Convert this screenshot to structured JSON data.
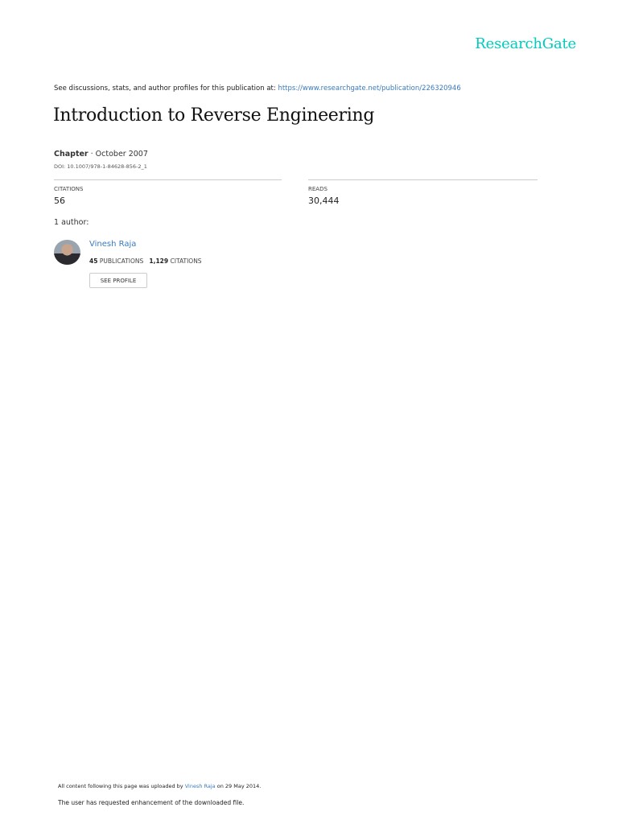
{
  "brand": {
    "logo": "ResearchGate",
    "accent": "#00ccbb",
    "link_color": "#3a7abf"
  },
  "header": {
    "intro": "See discussions, stats, and author profiles for this publication at: ",
    "url": "https://www.researchgate.net/publication/226320946"
  },
  "publication": {
    "title": "Introduction to Reverse Engineering",
    "type": "Chapter",
    "date": " · October 2007",
    "doi": "DOI: 10.1007/978-1-84628-856-2_1"
  },
  "stats": {
    "citations_label": "CITATIONS",
    "citations": "56",
    "reads_label": "READS",
    "reads": "30,444"
  },
  "authors": {
    "heading": "1 author:",
    "list": [
      {
        "name": "Vinesh Raja",
        "publications": "45",
        "publications_label": " PUBLICATIONS",
        "citations": "1,129",
        "citations_label": " CITATIONS",
        "button": "SEE PROFILE"
      }
    ]
  },
  "footer": {
    "uploaded_prefix": "All content following this page was uploaded by ",
    "uploader": "Vinesh Raja",
    "uploaded_suffix": " on 29 May 2014.",
    "note": "The user has requested enhancement of the downloaded file."
  }
}
